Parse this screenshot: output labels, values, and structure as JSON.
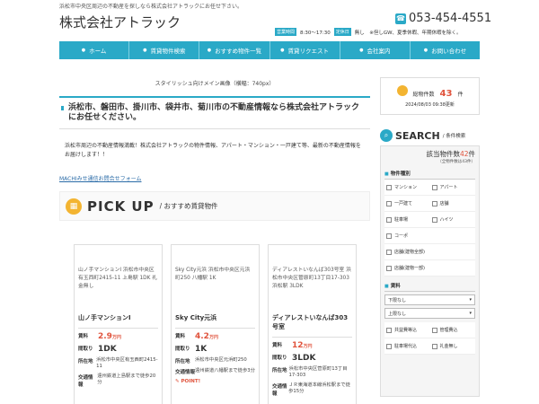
{
  "header": {
    "tagline": "浜松市中央区周辺の不動産を探しなら株式会社アトラックにお任せ下さい。",
    "logo": "株式会社アトラック",
    "phone": "053-454-4551",
    "hours_tag": "営業時間",
    "hours": "8:30～17:30",
    "holiday_tag": "定休日",
    "holiday": "無し　※但しGW、夏季休暇、年期休暇を除く。"
  },
  "nav": [
    "ホーム",
    "賃貸物件検索",
    "おすすめ物件一覧",
    "賃貸リクエスト",
    "会社案内",
    "お問い合わせ"
  ],
  "main": {
    "hero_alt": "スタイリッシュ向けメイン画像（横幅：740px）",
    "headline": "浜松市、磐田市、掛川市、袋井市、菊川市の不動産情報なら株式会社アトラックにお任せください。",
    "intro": "浜松市周辺の不動産情報満載！株式会社アトラックの物件情報、アパート・マンション・一戸建て等、最新の不動産情報をお届けします！！",
    "form_link": "MACHIみせ通信お問合せフォーム",
    "pickup_title": "PICK UP",
    "pickup_sub": "/ おすすめ賃貸物件"
  },
  "cards": [
    {
      "img_alt": "山ノ手マンションI 浜松市中央区有玉西町2415-11 上島駅 1DK 礼金無し",
      "name": "山ノ手マンションI",
      "rent_label": "賃料",
      "rent": "2.9",
      "rent_unit": "万円",
      "layout_label": "間取り",
      "layout": "1DK",
      "address_label": "所在地",
      "address": "浜松市中央区有玉西町2415-11",
      "access_label": "交通情報",
      "access": "遠州鉄道上島駅まで徒歩20分",
      "point": ""
    },
    {
      "img_alt": "Sky City元浜 浜松市中央区元浜町250 八幡駅 1K",
      "name": "Sky City元浜",
      "rent_label": "賃料",
      "rent": "4.2",
      "rent_unit": "万円",
      "layout_label": "間取り",
      "layout": "1K",
      "address_label": "所在地",
      "address": "浜松市中央区元浜町250",
      "access_label": "交通情報",
      "access": "遠州鉄道八幡駅まで徒歩3分",
      "point": "POINT!"
    },
    {
      "img_alt": "ディアレストいなんば303号室 浜松市中央区菅原町13丁目17-303 浜松駅 3LDK",
      "name": "ディアレストいなんば303号室",
      "rent_label": "賃料",
      "rent": "12",
      "rent_unit": "万円",
      "layout_label": "間取り",
      "layout": "3LDK",
      "address_label": "所在地",
      "address": "浜松市中央区菅原町13丁目17-303",
      "access_label": "交通情報",
      "access": "ＪＲ東海道本線浜松駅まで徒歩15分",
      "point": ""
    }
  ],
  "sidebar": {
    "count_label": "総物件数",
    "count": "43",
    "count_unit": "件",
    "updated": "2024/08/03 09:38更新",
    "search_title": "SEARCH",
    "search_sub": "/ 条件検索",
    "hit_prefix": "該当物件数",
    "hit_num": "42",
    "hit_unit": "件",
    "hit_note": "（全物件数は43件）",
    "type_title": "物件種別",
    "types": [
      "マンション",
      "アパート",
      "一戸建て",
      "店舗",
      "駐車場",
      "ハイツ",
      "コーポ",
      "店舗(建物全部)",
      "店舗(建物一部)"
    ],
    "rent_title": "賃料",
    "rent_min": "下限なし",
    "rent_max": "上限なし",
    "extras": [
      "共益費等込",
      "管理費込",
      "駐車場代込",
      "礼金無し"
    ]
  }
}
